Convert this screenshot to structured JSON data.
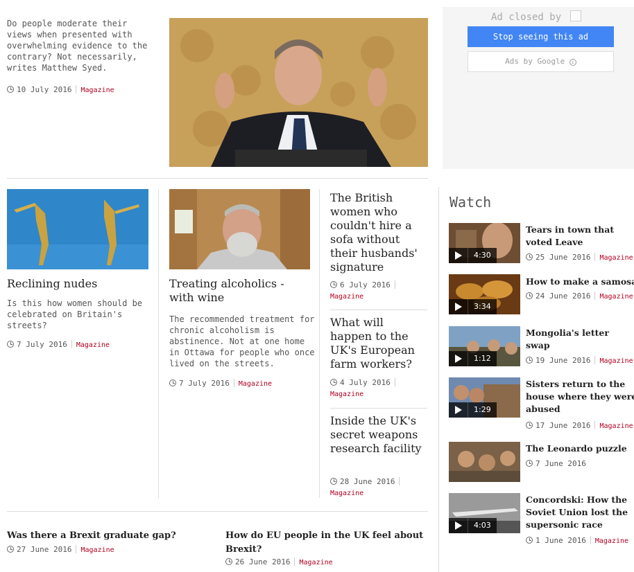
{
  "top_story": {
    "desc": "Do people moderate their views when presented with overwhelming evidence to the contrary? Not necessarily, writes Matthew Syed.",
    "date": "10 July 2016",
    "section": "Magazine"
  },
  "ad": {
    "closed_text": "Ad closed by",
    "stop_button": "Stop seeing this ad",
    "ads_by": "Ads by Google",
    "info_icon": "info-icon",
    "colors": {
      "button": "#4285f4"
    }
  },
  "articles": [
    {
      "title": "Reclining nudes",
      "desc": "Is this how women should be celebrated on Britain's streets?",
      "date": "7 July 2016",
      "section": "Magazine"
    },
    {
      "title": "Treating alcoholics - with wine",
      "desc": "The recommended treatment for chronic alcoholism is abstinence. Not at one home in Ottawa for people who once lived on the streets.",
      "date": "7 July 2016",
      "section": "Magazine"
    }
  ],
  "side_articles": [
    {
      "title": "The British women who couldn't hire a sofa without their husbands' signature",
      "date": "6 July 2016",
      "section": "Magazine"
    },
    {
      "title": "What will happen to the UK's European farm workers?",
      "date": "4 July 2016",
      "section": "Magazine"
    },
    {
      "title": "Inside the UK's secret weapons research facility",
      "date": "28 June 2016",
      "section": "Magazine"
    }
  ],
  "bottom_articles": [
    {
      "title": "Was there a Brexit graduate gap?",
      "date": "27 June 2016",
      "section": "Magazine"
    },
    {
      "title": "How do EU people in the UK feel about Brexit?",
      "date": "26 June 2016",
      "section": "Magazine"
    }
  ],
  "watch": {
    "heading": "Watch",
    "items": [
      {
        "title_lines": [
          "Tears in town that",
          "voted Leave"
        ],
        "duration": "4:30",
        "date": "25 June 2016",
        "section": "Magazine"
      },
      {
        "title_lines": [
          "How to make a samosa"
        ],
        "duration": "3:34",
        "date": "24 June 2016",
        "section": "Magazine"
      },
      {
        "title_lines": [
          "Mongolia's letter",
          "swap"
        ],
        "duration": "1:12",
        "date": "19 June 2016",
        "section": "Magazine"
      },
      {
        "title_lines": [
          "Sisters return to the",
          "house where they were",
          "abused"
        ],
        "duration": "1:29",
        "date": "17 June 2016",
        "section": "Magazine"
      },
      {
        "title_lines": [
          "The Leonardo puzzle"
        ],
        "duration": "",
        "date": "7 June 2016",
        "section": ""
      },
      {
        "title_lines": [
          "Concordski: How the",
          "Soviet Union lost the",
          "supersonic race"
        ],
        "duration": "4:03",
        "date": "1 June 2016",
        "section": "Magazine"
      }
    ]
  }
}
